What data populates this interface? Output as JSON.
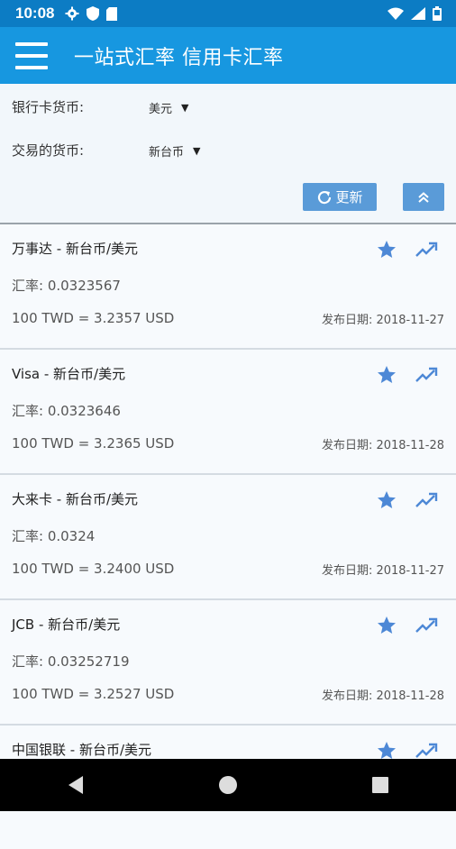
{
  "status_bar": {
    "time": "10:08",
    "left_icons": [
      "gear-icon",
      "shield-icon",
      "sd-card-icon"
    ],
    "right_icons": [
      "wifi-icon",
      "signal-icon",
      "battery-icon"
    ]
  },
  "app_bar": {
    "title": "一站式汇率 信用卡汇率"
  },
  "filters": {
    "bank_currency_label": "银行卡货币:",
    "bank_currency_value": "美元",
    "trade_currency_label": "交易的货币:",
    "trade_currency_value": "新台币",
    "refresh_label": "更新"
  },
  "cards": [
    {
      "title": "万事达 - 新台币/美元",
      "rate": "汇率: 0.0323567",
      "conversion": "100 TWD = 3.2357 USD",
      "date": "发布日期: 2018-11-27"
    },
    {
      "title": "Visa - 新台币/美元",
      "rate": "汇率: 0.0323646",
      "conversion": "100 TWD = 3.2365 USD",
      "date": "发布日期: 2018-11-28"
    },
    {
      "title": "大来卡 - 新台币/美元",
      "rate": "汇率: 0.0324",
      "conversion": "100 TWD = 3.2400 USD",
      "date": "发布日期: 2018-11-27"
    },
    {
      "title": "JCB - 新台币/美元",
      "rate": "汇率: 0.03252719",
      "conversion": "100 TWD = 3.2527 USD",
      "date": "发布日期: 2018-11-28"
    },
    {
      "title": "中国银联 - 新台币/美元",
      "rate": "",
      "conversion": "",
      "date": ""
    }
  ],
  "colors": {
    "status_bar": "#0c7cc4",
    "app_bar": "#1797e0",
    "accent": "#5a9bd8",
    "icon_blue": "#4d88d6"
  }
}
